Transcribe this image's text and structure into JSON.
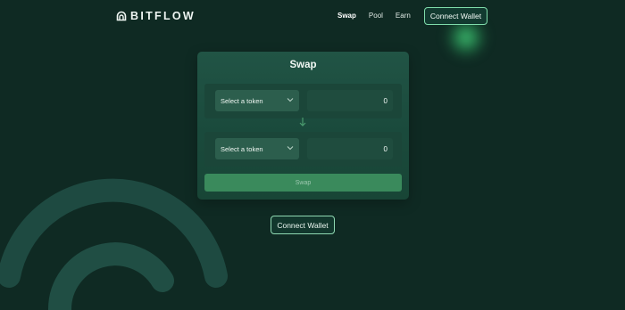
{
  "brand": {
    "name": "BITFLOW",
    "logo_icon": "bitflow-logo-icon"
  },
  "nav": {
    "links": [
      "Swap",
      "Pool",
      "Earn"
    ],
    "active": "Swap",
    "connect_label": "Connect Wallet"
  },
  "swap_card": {
    "title": "Swap",
    "from": {
      "token_placeholder": "Select a token",
      "amount": "0"
    },
    "to": {
      "token_placeholder": "Select a token",
      "amount": "0"
    },
    "arrow_icon": "arrow-down-icon",
    "swap_label": "Swap"
  },
  "connect_wallet_label": "Connect Wallet",
  "colors": {
    "background": "#0f2a23",
    "card": "#1e4e40",
    "accent": "#3a8a5c",
    "glow": "#48d67e"
  }
}
